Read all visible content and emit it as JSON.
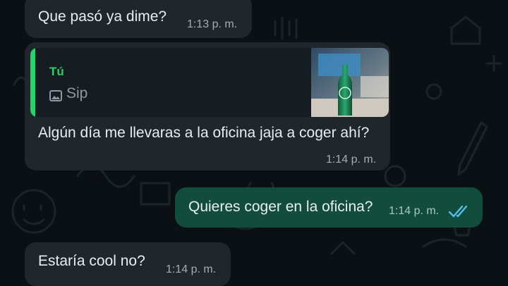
{
  "theme": {
    "background": "#0b1014",
    "incoming_bubble": "#1f272c",
    "outgoing_bubble": "#124d3b",
    "accent": "#25d366",
    "read_ticks": "#53bdeb"
  },
  "messages": [
    {
      "direction": "incoming",
      "text": "Que pasó ya dime?",
      "time": "1:13 p. m."
    },
    {
      "direction": "incoming",
      "reply_to": {
        "author": "Tú",
        "icon": "image-icon",
        "text": "Sip",
        "thumbnail": "bottle-on-table-photo"
      },
      "text": "Algún día me llevaras a la oficina jaja a coger ahí?",
      "time": "1:14 p. m."
    },
    {
      "direction": "outgoing",
      "text": "Quieres coger en la oficina?",
      "time": "1:14 p. m.",
      "status": "read",
      "status_icon": "double-check-icon"
    },
    {
      "direction": "incoming",
      "text": "Estaría cool no?",
      "time": "1:14 p. m."
    }
  ]
}
